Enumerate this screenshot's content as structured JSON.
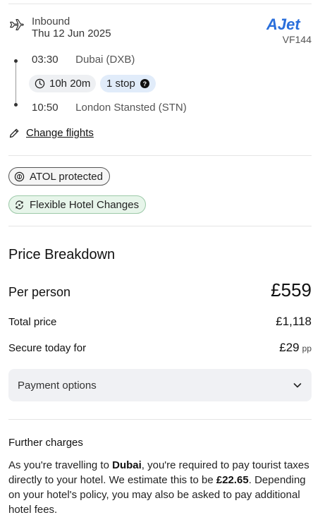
{
  "flight": {
    "direction": "Inbound",
    "date": "Thu 12 Jun 2025",
    "airline_logo_text": "AJet",
    "flight_number": "VF144",
    "departure": {
      "time": "03:30",
      "place": "Dubai (DXB)"
    },
    "duration": "10h 20m",
    "stops": "1 stop",
    "arrival": {
      "time": "10:50",
      "place": "London Stansted (STN)"
    },
    "change_flights_label": "Change flights"
  },
  "badges": {
    "atol": "ATOL protected",
    "hotel": "Flexible Hotel Changes"
  },
  "price": {
    "title": "Price Breakdown",
    "per_person_label": "Per person",
    "per_person_value": "£559",
    "total_label": "Total price",
    "total_value": "£1,118",
    "secure_label": "Secure today for",
    "secure_value": "£29",
    "secure_suffix": "pp",
    "payment_options_label": "Payment options"
  },
  "further": {
    "title": "Further charges",
    "text_1": "As you're travelling to ",
    "destination": "Dubai",
    "text_2": ", you're required to pay tourist taxes directly to your hotel. We estimate this to be ",
    "amount": "£22.65",
    "text_3": ". Depending on your hotel's policy, you may also be asked to pay additional hotel fees."
  },
  "colors": {
    "airline_brand": "#2a6fdb",
    "stops_pill": "#e1ecfa",
    "flexible_badge": "#e7f5ea"
  },
  "icons": {
    "plane": "plane-icon",
    "clock": "clock-icon",
    "help": "help-icon",
    "pencil": "pencil-icon",
    "atol": "atol-icon",
    "hotel": "hotel-flex-icon",
    "chevron": "chevron-down-icon"
  }
}
